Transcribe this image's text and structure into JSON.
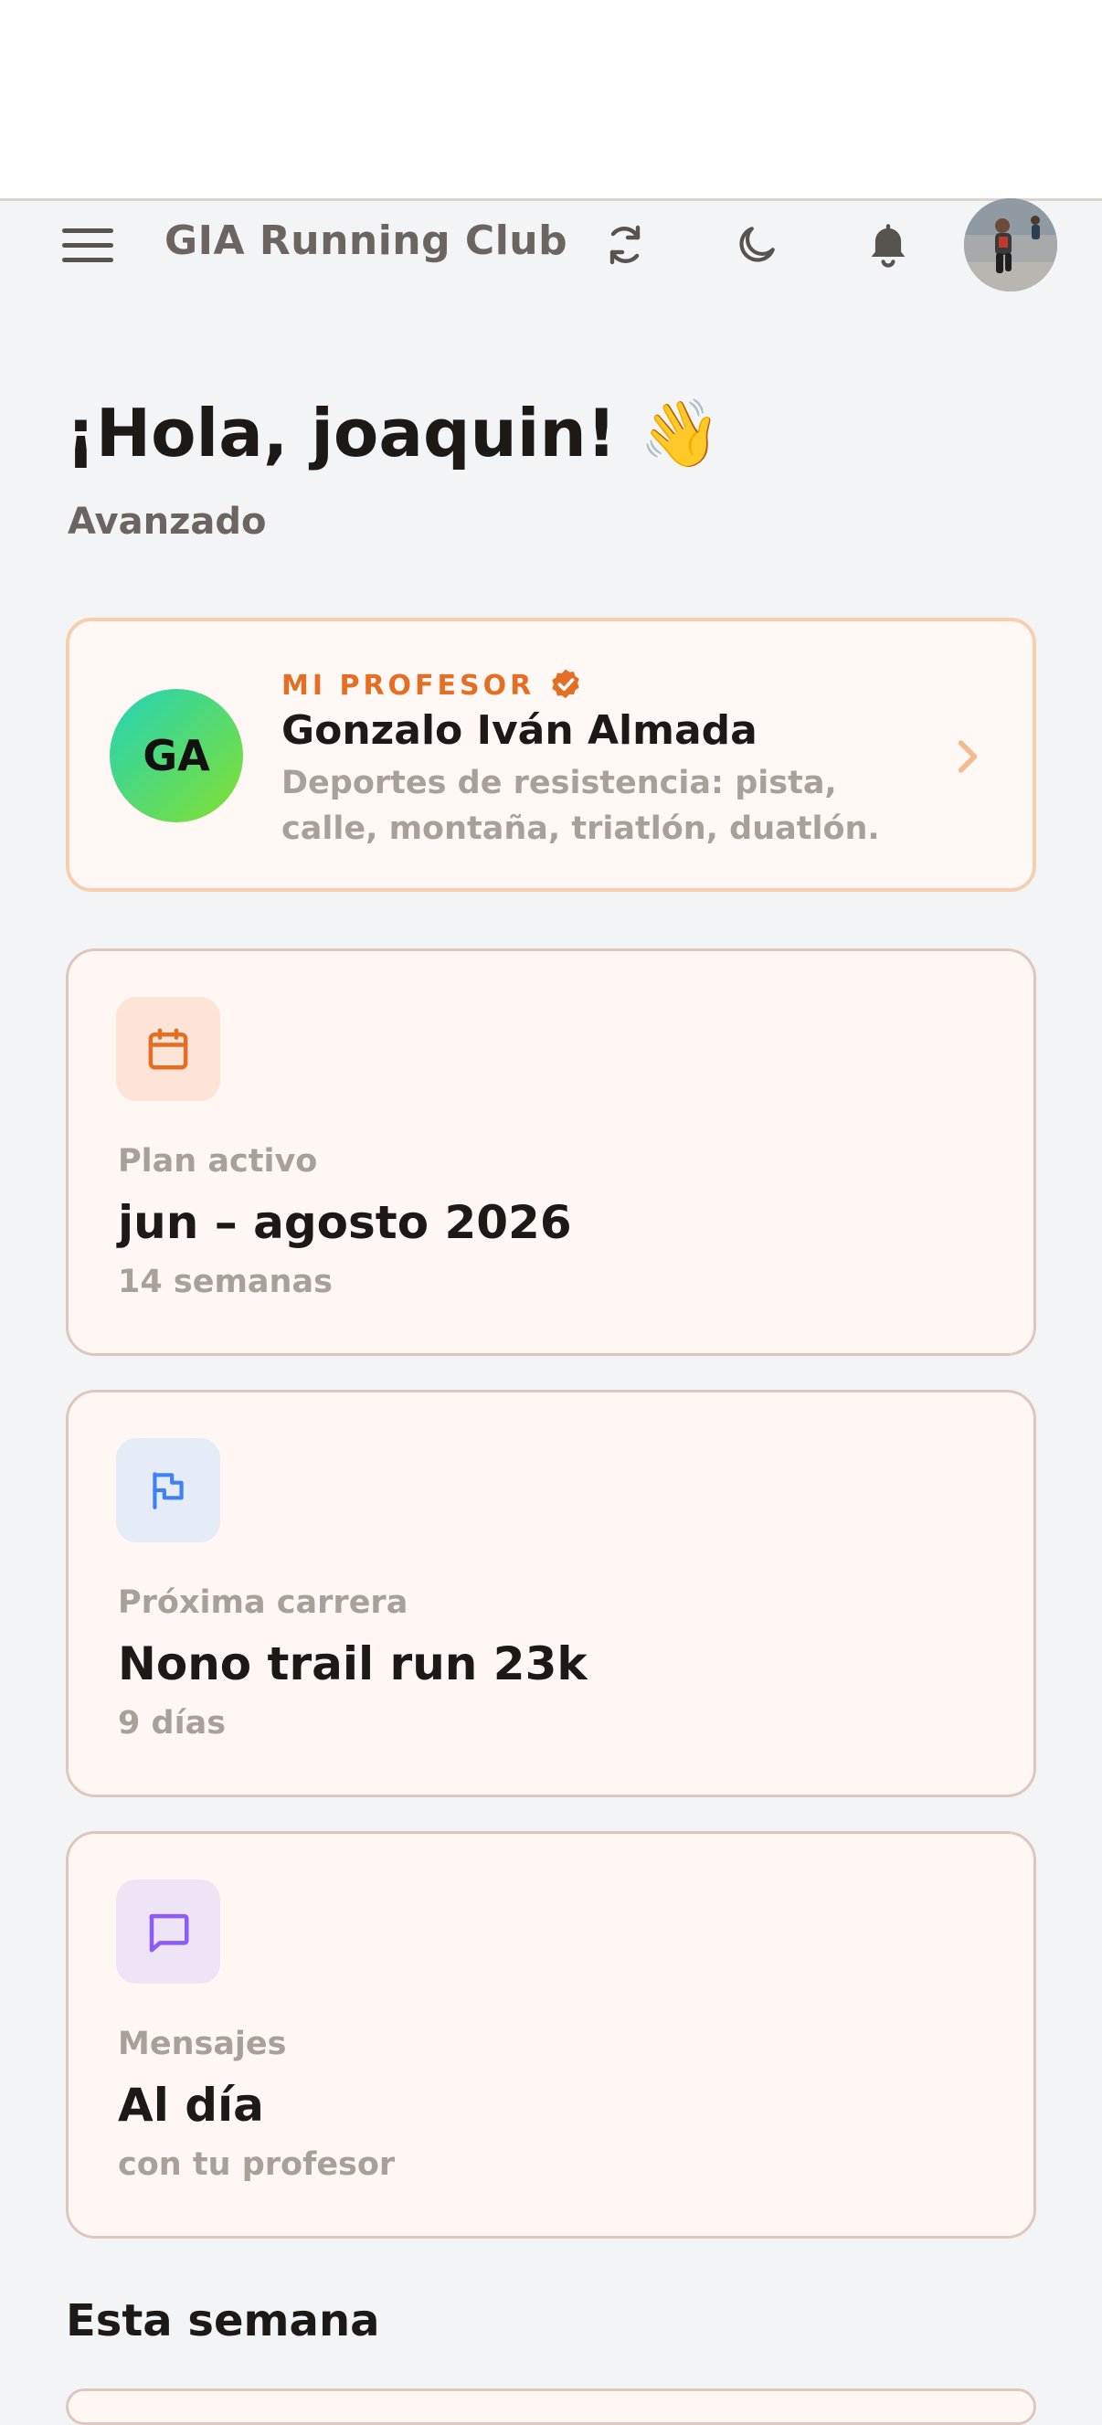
{
  "header": {
    "title": "GIA Running Club",
    "menu_icon": "hamburger-menu-icon",
    "icons": [
      "sync-icon",
      "moon-icon",
      "bell-icon"
    ]
  },
  "greeting": {
    "text": "¡Hola, joaquin! 👋",
    "level": "Avanzado"
  },
  "professor": {
    "kicker": "MI PROFESOR",
    "initials": "GA",
    "name": "Gonzalo Iván Almada",
    "description": "Deportes de resistencia: pista, calle, montaña, triatlón, duatlón."
  },
  "cards": [
    {
      "icon": "calendar-icon",
      "label": "Plan activo",
      "value": "jun – agosto 2026",
      "sub": "14 semanas",
      "icon_color": "#e46f24",
      "icon_bg": "#fde4d6"
    },
    {
      "icon": "flag-icon",
      "label": "Próxima carrera",
      "value": "Nono trail run 23k",
      "sub": "9 días",
      "icon_color": "#3b82f6",
      "icon_bg": "#e6ebf8"
    },
    {
      "icon": "message-icon",
      "label": "Mensajes",
      "value": "Al día",
      "sub": "con tu profesor",
      "icon_color": "#8b5cf6",
      "icon_bg": "#efe3f6"
    }
  ],
  "section": {
    "title": "Esta semana"
  },
  "colors": {
    "accent": "#e46f24",
    "card_bg": "#fff7f4",
    "page_bg": "#f3f4f6"
  }
}
